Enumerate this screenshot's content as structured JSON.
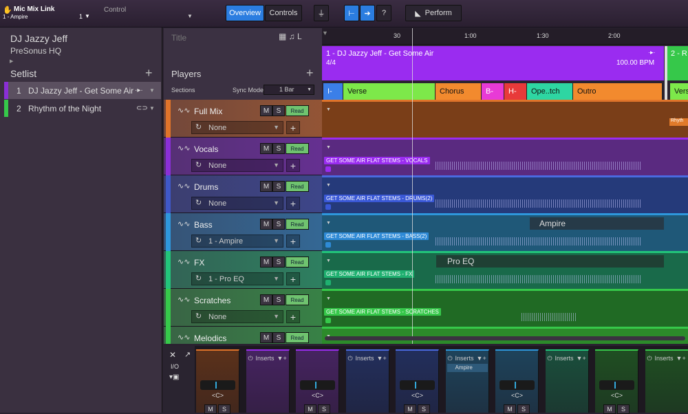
{
  "top": {
    "app_title": "Mic Mix Link",
    "song_selector": "1 - Ampire",
    "song_num": "1",
    "control_label": "Control",
    "overview_btn": "Overview",
    "controls_btn": "Controls",
    "help": "?",
    "perform_btn": "Perform"
  },
  "sidebar": {
    "artist": "DJ Jazzy Jeff",
    "venue": "PreSonus HQ",
    "setlist_label": "Setlist",
    "songs": [
      {
        "num": "1",
        "title": "DJ Jazzy Jeff - Get Some Air"
      },
      {
        "num": "2",
        "title": "Rhythm of the Night"
      }
    ]
  },
  "tracks": {
    "title_placeholder": "Title",
    "players_label": "Players",
    "sections_label": "Sections",
    "syncmode_label": "Sync Mode",
    "syncmode_value": "1 Bar",
    "list": [
      {
        "name": "Full Mix",
        "insert": "None",
        "color": "#e0742a",
        "m": "M",
        "s": "S",
        "read": "Read"
      },
      {
        "name": "Vocals",
        "insert": "None",
        "color": "#8a2fd6",
        "m": "M",
        "s": "S",
        "read": "Read"
      },
      {
        "name": "Drums",
        "insert": "None",
        "color": "#3f58c8",
        "m": "M",
        "s": "S",
        "read": "Read"
      },
      {
        "name": "Bass",
        "insert": "1 - Ampire",
        "color": "#2e97dc",
        "m": "M",
        "s": "S",
        "read": "Read"
      },
      {
        "name": "FX",
        "insert": "1 - Pro EQ",
        "color": "#22c47a",
        "m": "M",
        "s": "S",
        "read": "Read"
      },
      {
        "name": "Scratches",
        "insert": "None",
        "color": "#36c84a",
        "m": "M",
        "s": "S",
        "read": "Read"
      },
      {
        "name": "Melodics",
        "insert": "",
        "color": "#36c84a",
        "m": "M",
        "s": "S",
        "read": "Read"
      }
    ]
  },
  "timeline": {
    "marks": [
      "30",
      "1:00",
      "1:30",
      "2:00"
    ]
  },
  "song_header": {
    "title": "1 -  DJ Jazzy Jeff - Get Some Air",
    "meter": "4/4",
    "bpm": "100.00 BPM",
    "next_title": "2 - R"
  },
  "sections": [
    {
      "label": "I-",
      "color": "#3b7fe8"
    },
    {
      "label": "Verse",
      "color": "#7de84a"
    },
    {
      "label": "Chorus",
      "color": "#f28a2e"
    },
    {
      "label": "B-",
      "color": "#e83ad6"
    },
    {
      "label": "H-",
      "color": "#e83a3a"
    },
    {
      "label": "Ope..tch",
      "color": "#2ed6a2"
    },
    {
      "label": "Outro",
      "color": "#f28a2e"
    },
    {
      "label": "Vers",
      "color": "#7de84a"
    }
  ],
  "clips": [
    "GET SOME AIR FLAT STEMS - VOCALS",
    "GET SOME AIR FLAT STEMS - DRUMS(2)",
    "GET SOME AIR FLAT STEMS - BASS(2)",
    "GET SOME AIR FLAT STEMS - FX",
    "GET SOME AIR FLAT STEMS - SCRATCHES"
  ],
  "lane_labels": {
    "bass": "Ampire",
    "fx": "Pro EQ",
    "next_clip": "Rhyth"
  },
  "mixer": {
    "io": "I/O",
    "inserts": "Inserts",
    "ampire_insert": "Ampire",
    "center": "<C>",
    "m": "M",
    "s": "S"
  }
}
